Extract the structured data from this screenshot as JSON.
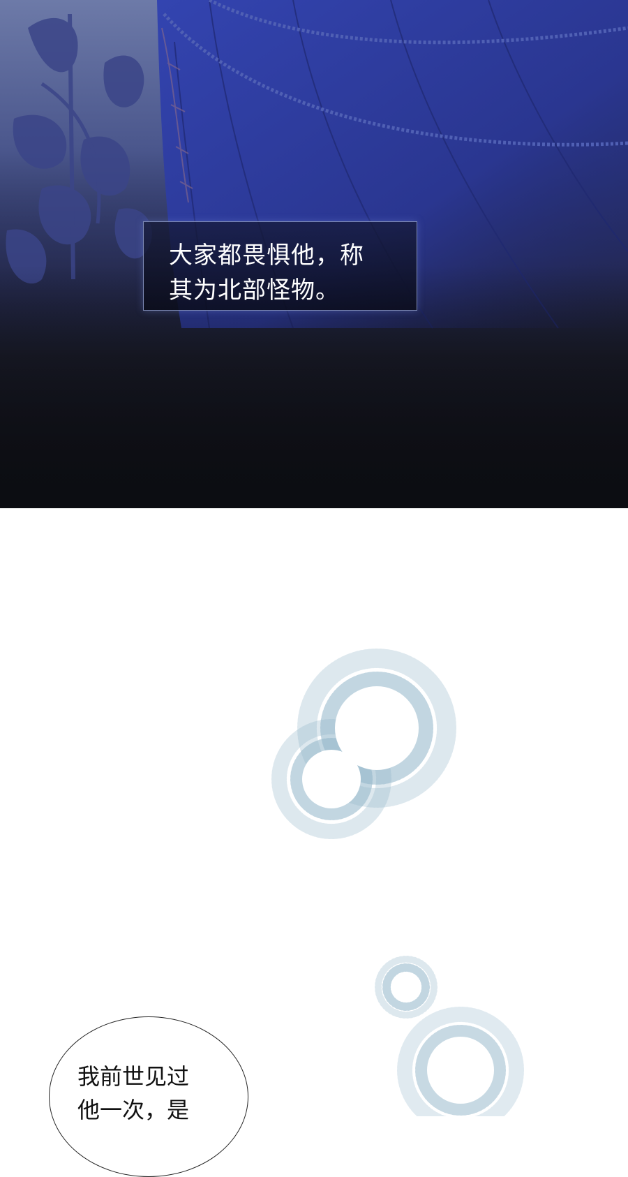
{
  "panels": {
    "top": {
      "caption": {
        "line1": "大家都畏惧他，称",
        "line2": "其为北部怪物。"
      }
    },
    "bottom": {
      "speech_bubble": {
        "line1": "我前世见过",
        "line2": "他一次，是"
      }
    }
  },
  "colors": {
    "deep_blue": "#2f3f96",
    "night_black": "#0c0d12",
    "caption_border": "#7d89b4",
    "sparkle_blue": "#8fb4c8"
  }
}
